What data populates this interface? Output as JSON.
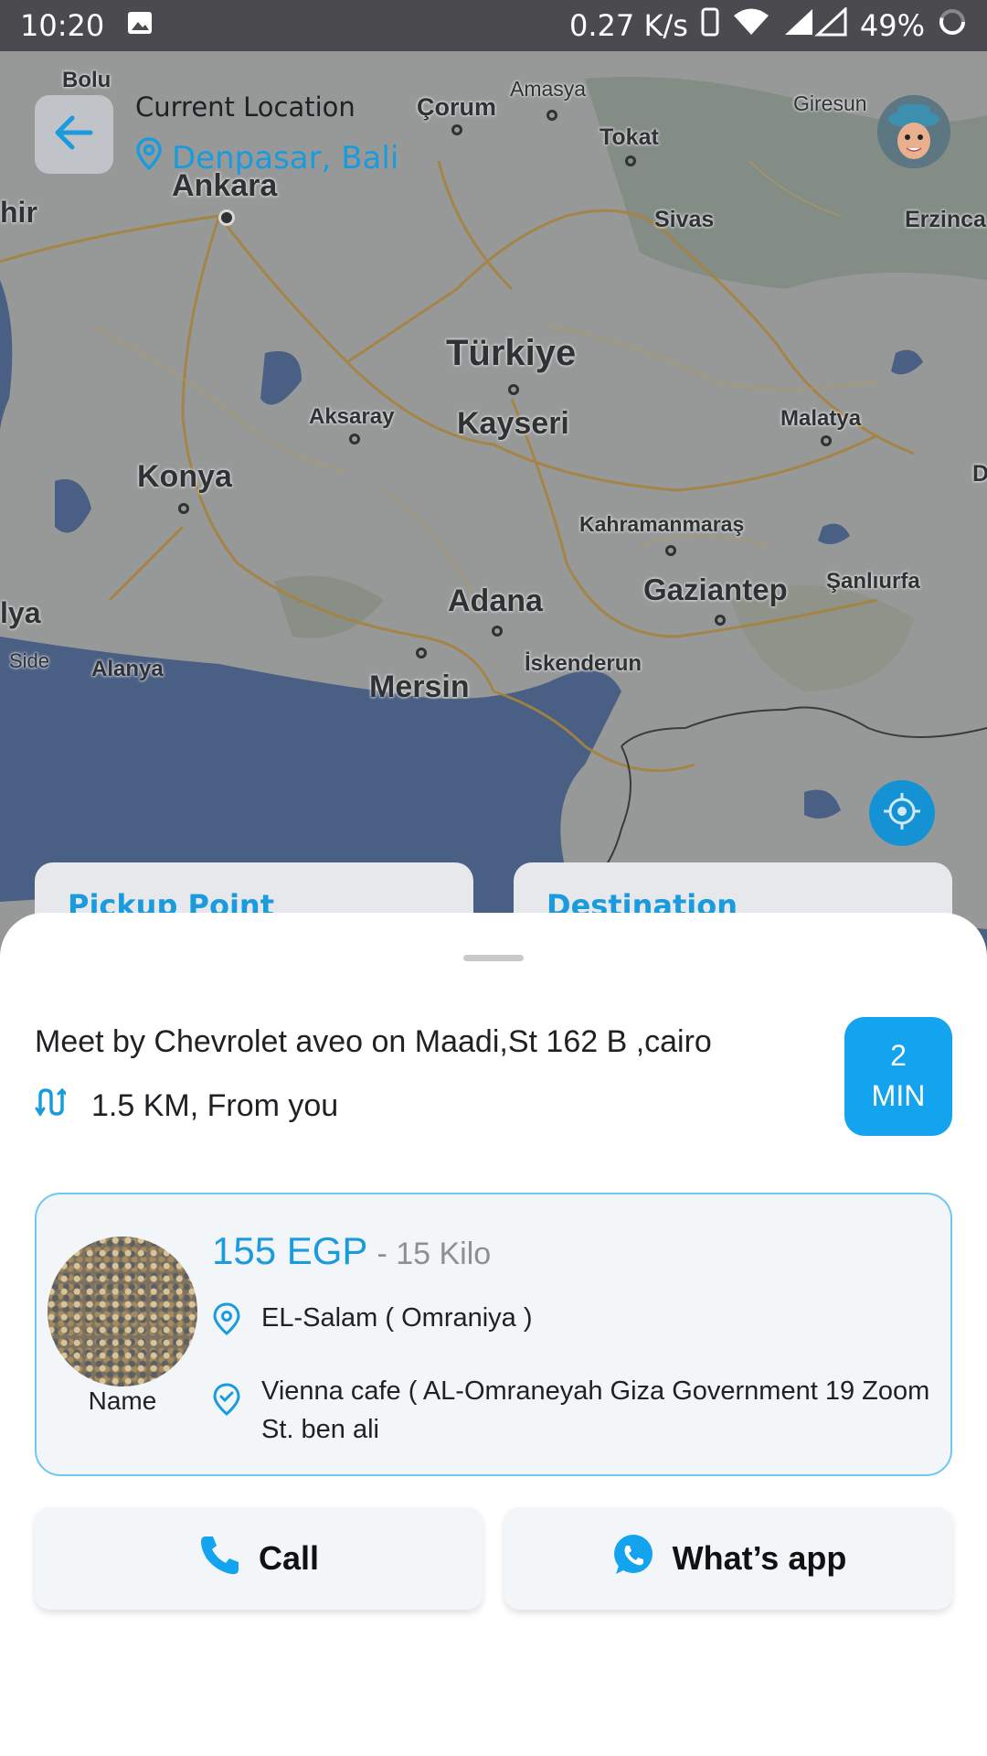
{
  "status_bar": {
    "time": "10:20",
    "speed": "0.27 K/s",
    "battery": "49%"
  },
  "header": {
    "location_label": "Current Location",
    "location_value": "Denpasar, Bali"
  },
  "map": {
    "labels": [
      "Bolu",
      "Amasya",
      "Giresun",
      "Çorum",
      "Tokat",
      "Ankara",
      "Sivas",
      "Erzinca",
      "hir",
      "Türkiye",
      "Kayseri",
      "Aksaray",
      "Malatya",
      "Konya",
      "Kahramanmaraş",
      "Gaziantep",
      "Şanlıurfa",
      "Adana",
      "lya",
      "Side",
      "Alanya",
      "İskenderun",
      "Mersin",
      "D"
    ]
  },
  "peek_cards": {
    "pickup": "Pickup Point",
    "destination": "Destination"
  },
  "sheet": {
    "meet_text": "Meet by Chevrolet aveo on Maadi,St 162 B ,cairo",
    "distance": "1.5 KM, From you",
    "eta_value": "2",
    "eta_unit": "MIN",
    "order": {
      "product_name": "Name",
      "price": "155 EGP",
      "weight": "- 15 Kilo",
      "pickup": "EL-Salam ( Omraniya )",
      "destination": "Vienna cafe ( AL-Omraneyah Giza Government 19 Zoom St. ben ali"
    },
    "buttons": {
      "call": "Call",
      "whatsapp": "What’s app"
    }
  },
  "colors": {
    "accent": "#13a3ef",
    "text": "#202124",
    "muted": "#8d8f93"
  }
}
